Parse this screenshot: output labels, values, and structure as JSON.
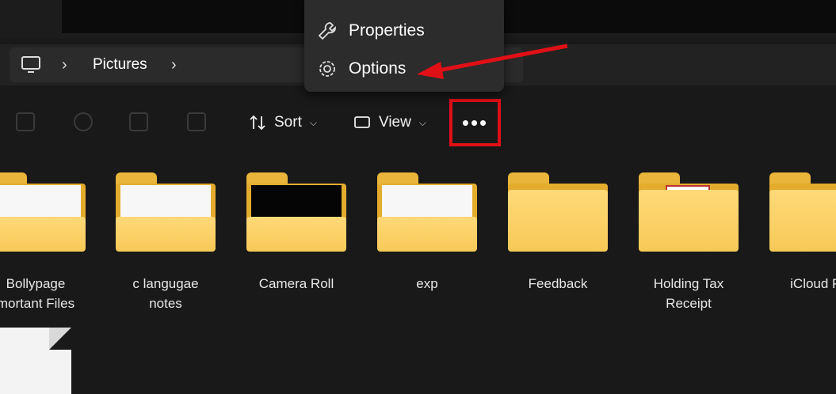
{
  "breadcrumb": {
    "items": [
      "Pictures"
    ]
  },
  "context_menu": {
    "items": [
      {
        "label": "Properties",
        "icon": "wrench-icon"
      },
      {
        "label": "Options",
        "icon": "gear-icon"
      }
    ]
  },
  "toolbar": {
    "sort_label": "Sort",
    "view_label": "View",
    "more_label": "•••"
  },
  "folders": [
    {
      "name": "Bollypage",
      "name2": "mortant Files",
      "style": "paper"
    },
    {
      "name": "c langugae notes",
      "style": "paper"
    },
    {
      "name": "Camera Roll",
      "style": "dark"
    },
    {
      "name": "exp",
      "style": "paper"
    },
    {
      "name": "Feedback",
      "style": "plain"
    },
    {
      "name": "Holding Tax",
      "name2": "Receipt",
      "style": "pdf"
    },
    {
      "name": "iCloud Ph",
      "style": "plain"
    }
  ],
  "colors": {
    "highlight_box": "#e10f16",
    "arrow": "#e10f16",
    "folder": "#f7c957"
  }
}
